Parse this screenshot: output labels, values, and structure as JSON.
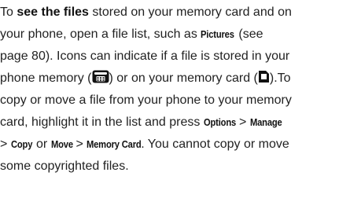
{
  "line1": {
    "t1": "To ",
    "bold": "see the files",
    "t2": " stored on your memory card and on"
  },
  "line2": {
    "t1": "your phone, open a file list, such as ",
    "pictures": "Pictures",
    "t2": " (see"
  },
  "line3": {
    "t1": "page 80). Icons can indicate if a file is stored in your"
  },
  "line4": {
    "t1": "phone memory (",
    "t2": ") or on your memory card (",
    "t3": ").To"
  },
  "line5": {
    "t1": "copy or move a file from your phone to your memory"
  },
  "line6": {
    "t1": "card, highlight it in the list and press ",
    "options": "Options",
    "t2": " > ",
    "manage": "Manage"
  },
  "line7": {
    "t1": "> ",
    "copy": "Copy",
    "t2": " or ",
    "move": "Move",
    "t3": " > ",
    "memory_card": "Memory Card",
    "t4": ". You cannot copy or move"
  },
  "line8": {
    "t1": "some copyrighted files."
  },
  "icons": {
    "phone_memory": "phone-memory-icon",
    "memory_card": "memory-card-icon"
  }
}
